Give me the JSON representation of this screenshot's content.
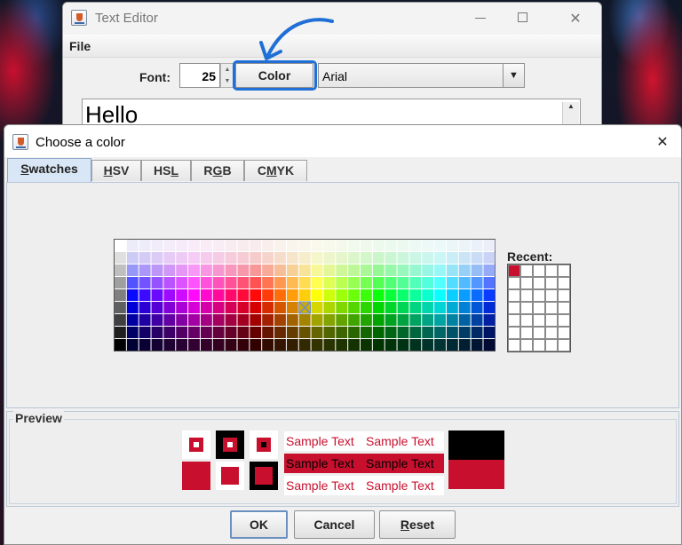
{
  "editor": {
    "title": "Text Editor",
    "menu_file": "File",
    "font_label": "Font:",
    "font_size": "25",
    "color_button": "Color",
    "font_family": "Arial",
    "text": "Hello"
  },
  "chooser": {
    "title": "Choose a color",
    "tabs": [
      {
        "label": "Swatches",
        "key": "S",
        "rest": "watches"
      },
      {
        "label": "HSV",
        "key": "H",
        "rest": "SV"
      },
      {
        "label": "HSL",
        "pre": "HS",
        "key": "L"
      },
      {
        "label": "RGB",
        "pre": "R",
        "key": "G",
        "rest": "B"
      },
      {
        "label": "CMYK",
        "pre": "C",
        "key": "M",
        "rest": "YK"
      }
    ],
    "active_tab": "Swatches",
    "recent_label": "Recent:",
    "recent_colors": [
      "#c8102e"
    ],
    "selected_color": "#c8102e",
    "preview_label": "Preview",
    "sample_text": "Sample Text",
    "buttons": {
      "ok": "OK",
      "cancel": "Cancel",
      "reset_key": "R",
      "reset_rest": "eset"
    }
  },
  "colors": {
    "accent": "#1f6fd6",
    "selected": "#c8102e",
    "tab_active": "#d9e6f5"
  },
  "icons": [
    "java-app-icon",
    "minimize-icon",
    "maximize-icon",
    "close-icon",
    "chevron-down-icon",
    "spinner-icon"
  ]
}
